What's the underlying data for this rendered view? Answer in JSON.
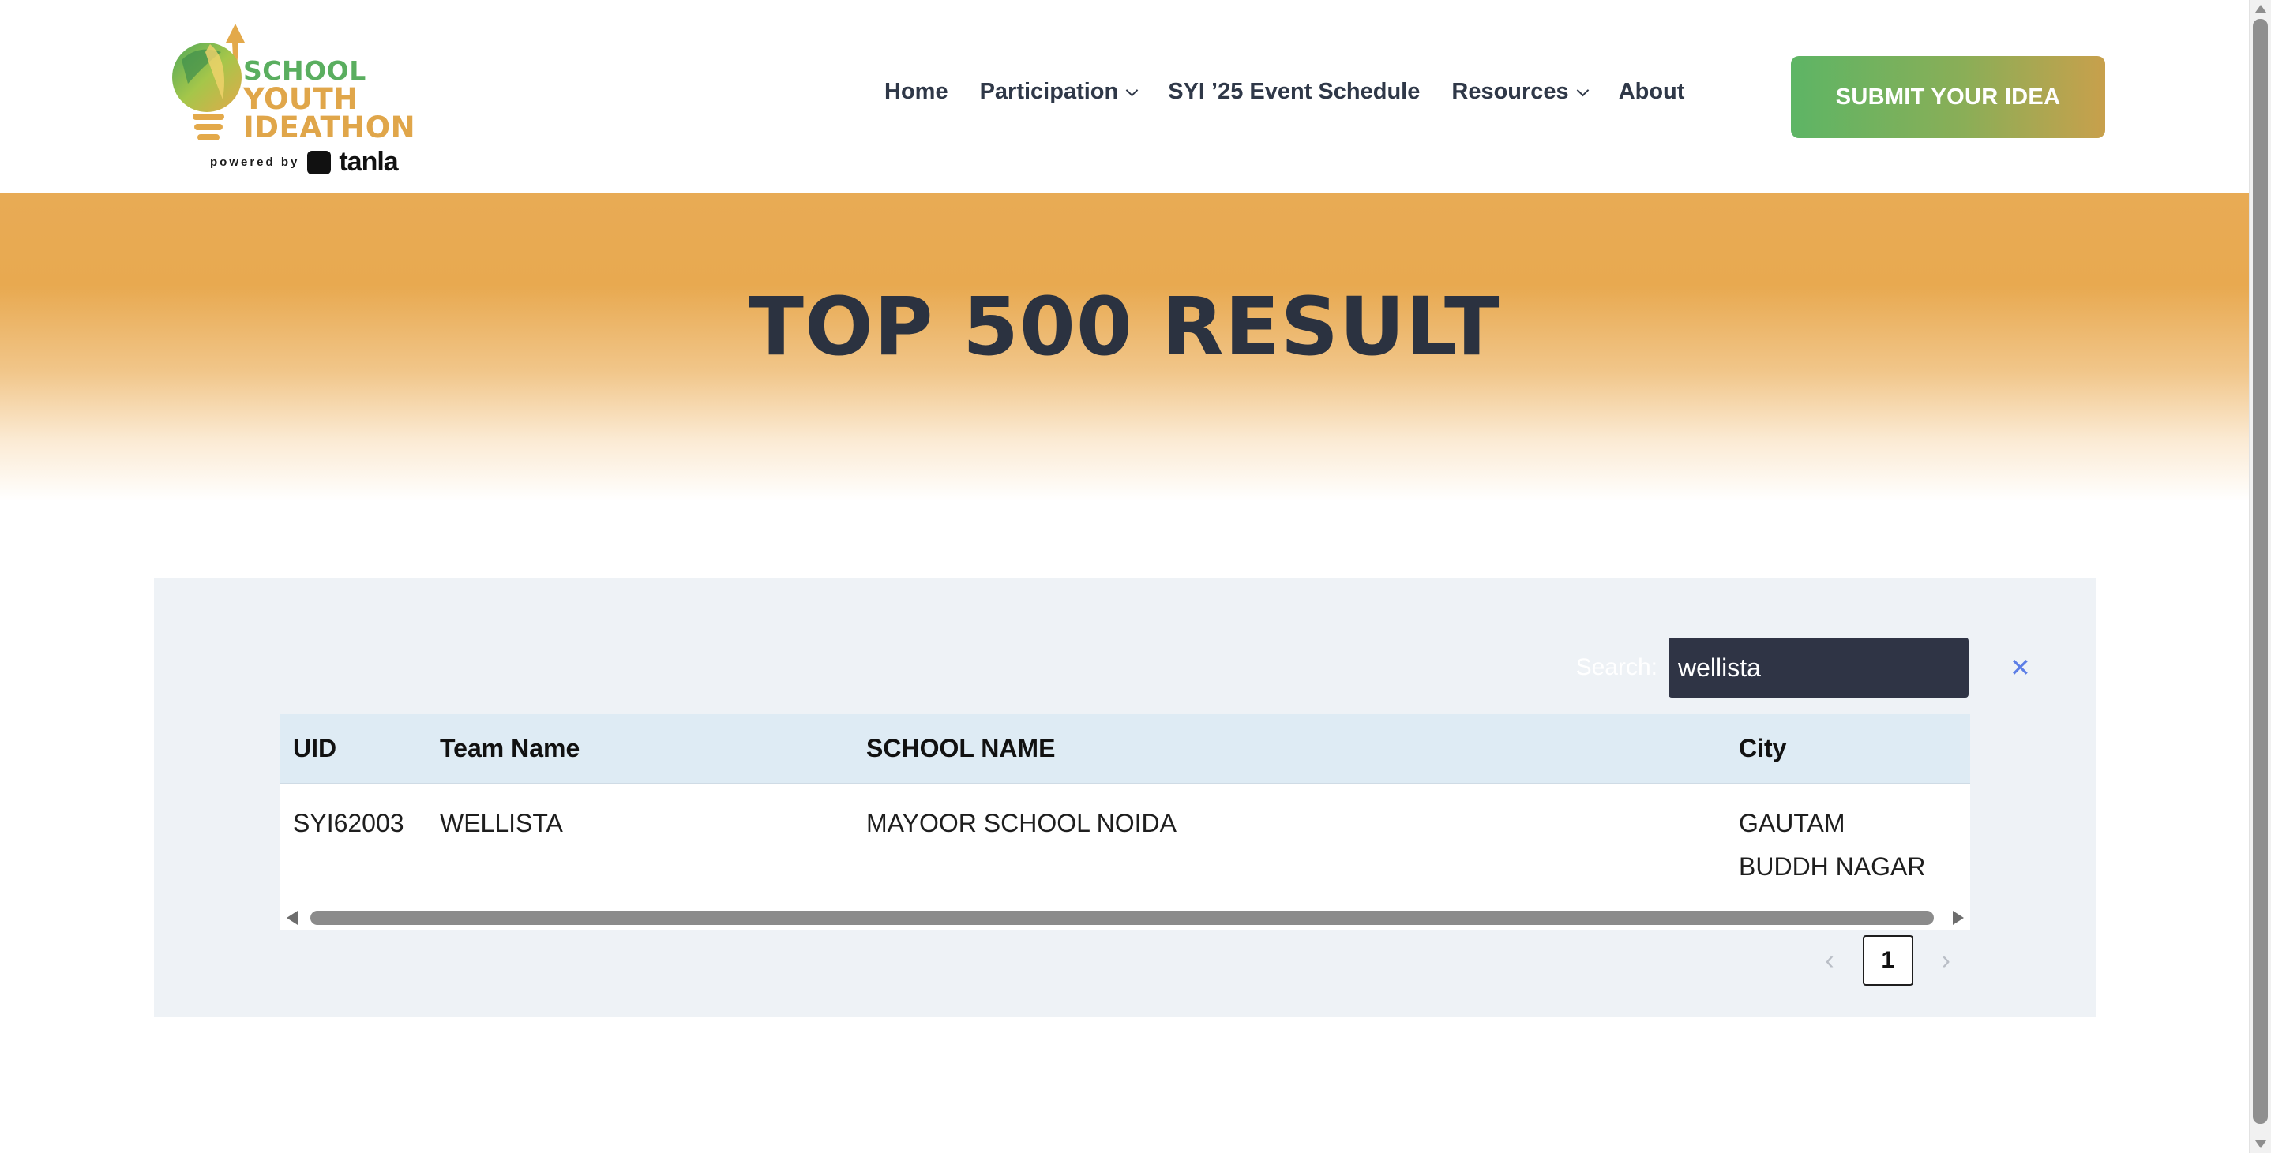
{
  "logo": {
    "line1": "SCHOOL",
    "line2": "YOUTH",
    "line3": "IDEATHON",
    "powered_by": "powered by",
    "partner": "tanla",
    "icon": "lightbulb-arrow-icon"
  },
  "nav": {
    "items": [
      {
        "label": "Home",
        "has_dropdown": false
      },
      {
        "label": "Participation",
        "has_dropdown": true
      },
      {
        "label": "SYI ’25 Event Schedule",
        "has_dropdown": false
      },
      {
        "label": "Resources",
        "has_dropdown": true
      },
      {
        "label": "About",
        "has_dropdown": false
      }
    ],
    "cta_label": "SUBMIT YOUR IDEA"
  },
  "hero": {
    "title": "TOP 500 RESULT"
  },
  "search": {
    "label": "Search:",
    "value": "wellista",
    "clear_icon": "close-icon"
  },
  "table": {
    "columns": [
      "UID",
      "Team Name",
      "SCHOOL NAME",
      "City"
    ],
    "rows": [
      [
        "SYI62003",
        "WELLISTA",
        "MAYOOR SCHOOL NOIDA",
        "GAUTAM BUDDH NAGAR"
      ]
    ]
  },
  "pagination": {
    "prev": "‹",
    "current_page": "1",
    "next": "›"
  },
  "colors": {
    "accent_orange": "#e8ab55",
    "accent_green": "#5db565",
    "text_dark": "#2b3240",
    "search_bg": "#2f3445"
  }
}
